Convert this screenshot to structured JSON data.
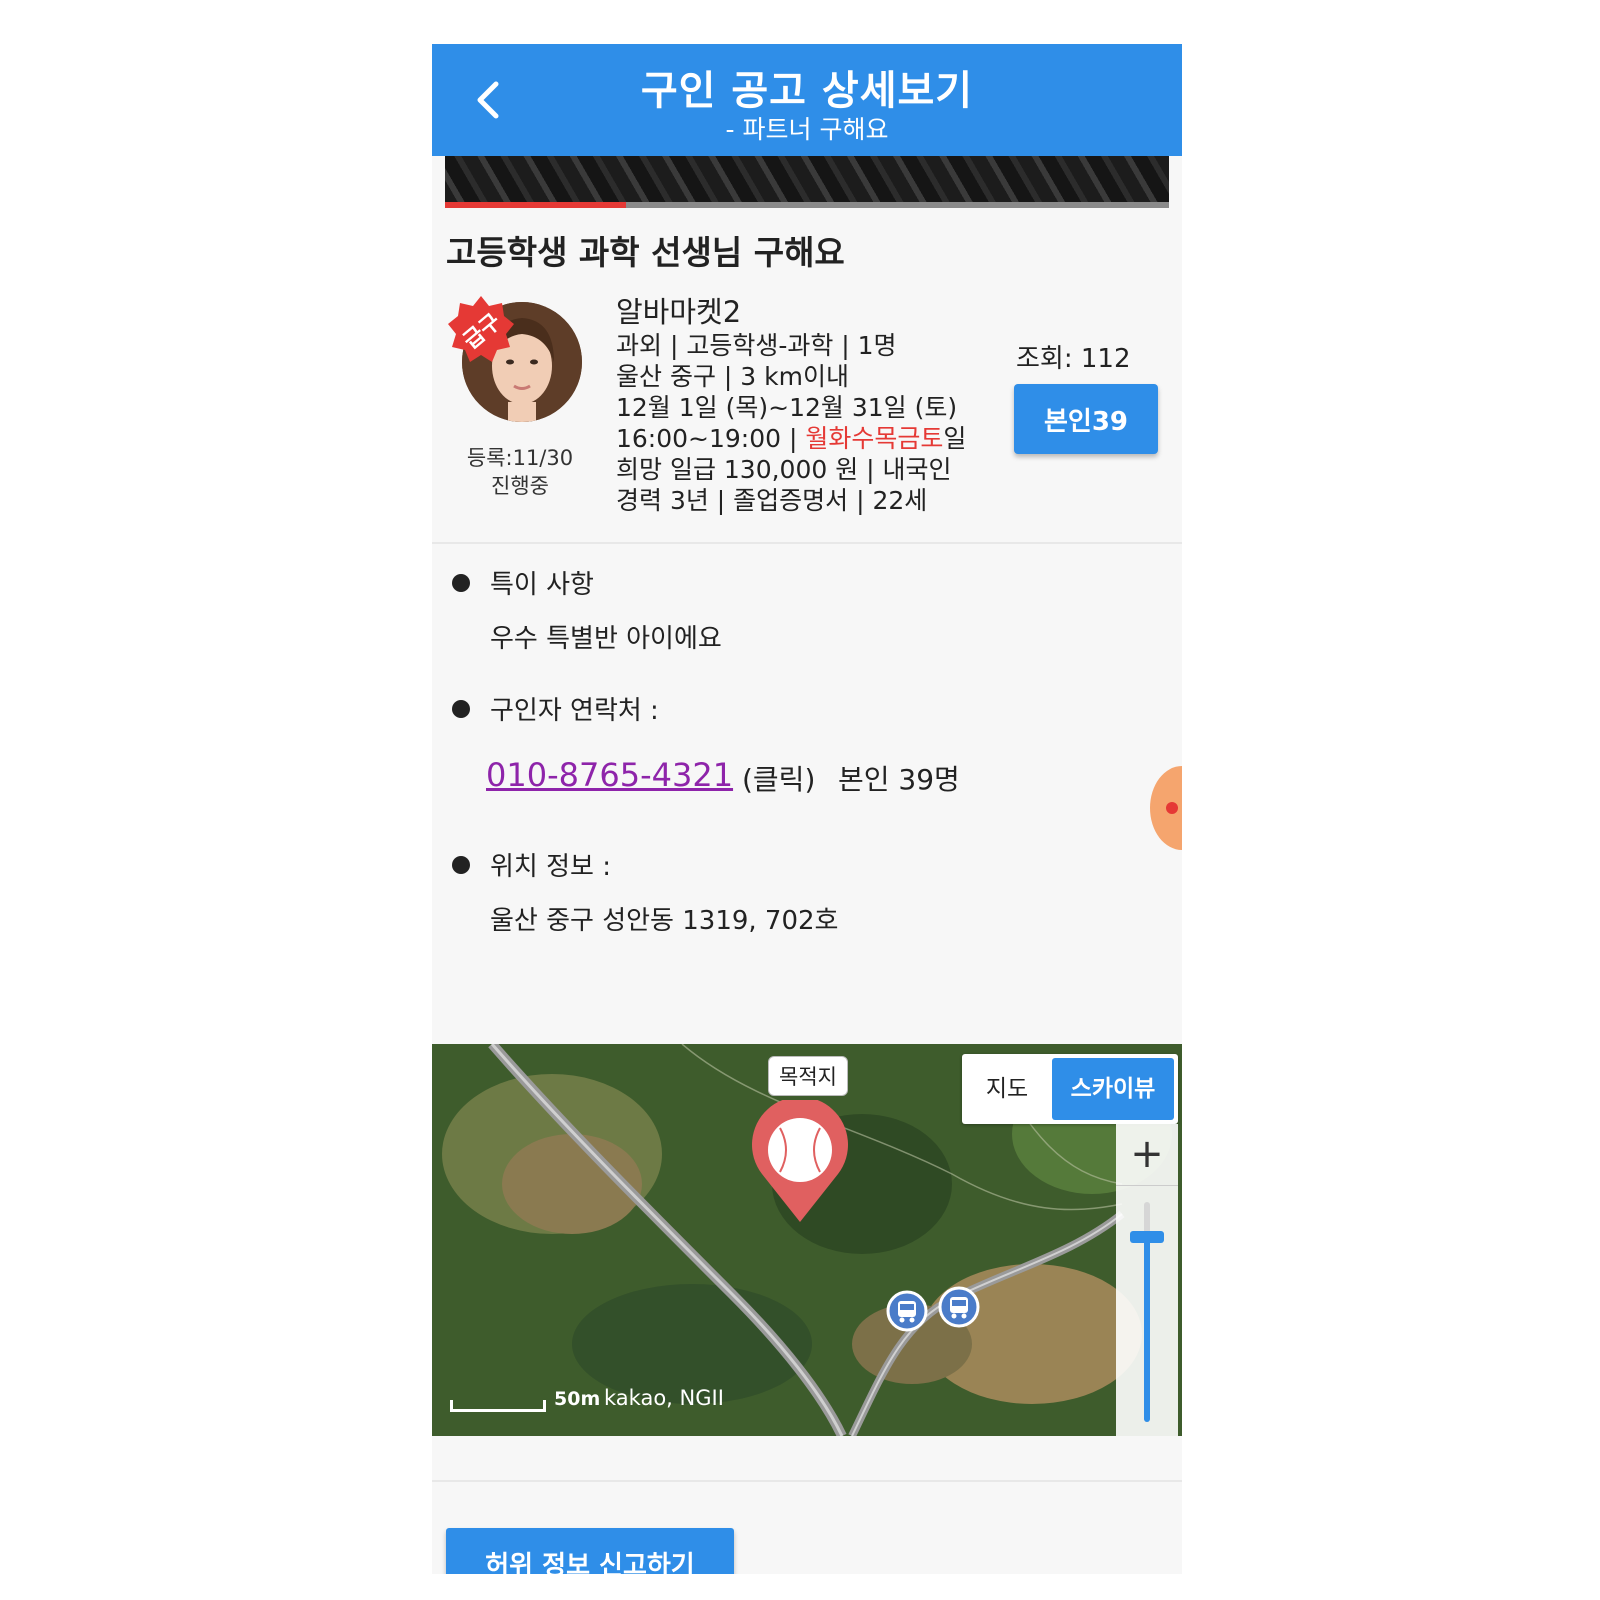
{
  "header": {
    "title": "구인 공고 상세보기",
    "subtitle": "- 파트너 구해요"
  },
  "video": {
    "progress": 0.25
  },
  "post": {
    "title": "고등학생 과학 선생님 구해요",
    "urgent_badge": "급구",
    "registered": "등록:11/30",
    "status": "진행중",
    "name": "알바마켓2",
    "category_line": "과외 | 고등학생-과학 | 1명",
    "location_line": "울산 중구 | 3 km이내",
    "date_range": "12월 1일 (목)~12월 31일 (토)",
    "time_prefix": "16:00~19:00 | ",
    "weekdays": "월화수목금토",
    "weekday_suffix": "일",
    "pay_line": "희망 일급 130,000 원 | 내국인",
    "career_line": "경력 3년 | 졸업증명서 | 22세",
    "views": "조회:  112",
    "verify_button": "본인39"
  },
  "details": {
    "notes_label": "특이 사항",
    "notes_value": "우수 특별반 아이에요",
    "contact_label": "구인자 연락처 :",
    "phone": "010-8765-4321",
    "click_hint": "(클릭)",
    "verified_count": "본인 39명",
    "location_label": "위치 정보 :",
    "address": "울산 중구 성안동 1319,  702호"
  },
  "map": {
    "destination_label": "목적지",
    "type_map": "지도",
    "type_skyview": "스카이뷰",
    "selected_type": "스카이뷰",
    "zoom_in": "+",
    "zoom_level": 0.84,
    "scale": "50m",
    "copyright": "kakao, NGII"
  },
  "report_button": "허위 정보 신고하기",
  "colors": {
    "primary": "#2f8ee8",
    "accent_red": "#e53935",
    "link_purple": "#8e24aa"
  },
  "icons": [
    "back-arrow-icon",
    "map-pin-icon",
    "baseball-icon",
    "bus-stop-icon",
    "zoom-in-icon"
  ]
}
